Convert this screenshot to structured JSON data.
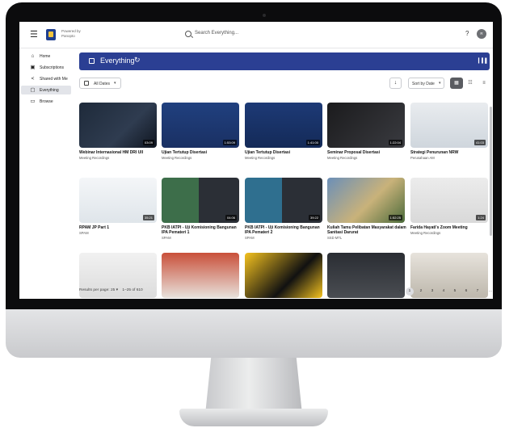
{
  "header": {
    "powered_by": "Powered by Panopto",
    "search_placeholder": "Search Everything...",
    "help": "?",
    "avatar_initials": "R"
  },
  "sidebar": {
    "items": [
      {
        "label": "Home",
        "icon": "home-icon",
        "glyph": "⌂"
      },
      {
        "label": "Subscriptions",
        "icon": "subscriptions-icon",
        "glyph": "▣"
      },
      {
        "label": "Shared with Me",
        "icon": "share-icon",
        "glyph": "<"
      },
      {
        "label": "Everything",
        "icon": "everything-icon",
        "glyph": "▢",
        "active": true
      },
      {
        "label": "Browse",
        "icon": "folder-icon",
        "glyph": "▭"
      }
    ]
  },
  "main": {
    "title": "Everything",
    "filter_label": "All Dates",
    "sort_label": "Sort by Date",
    "accent_color": "#2b3f93"
  },
  "sessions": [
    {
      "title": "Webinar Internasional HM DRI UII",
      "folder": "Meeting Recordings",
      "duration": "03:09"
    },
    {
      "title": "Ujian Tertutup Disertasi",
      "folder": "Meeting Recordings",
      "duration": "1:53:09"
    },
    {
      "title": "Ujian Tertutup Disertasi",
      "folder": "Meeting Recordings",
      "duration": "1:41:00"
    },
    {
      "title": "Seminar Proposal Disertasi",
      "folder": "Meeting Recordings",
      "duration": "1:22:04"
    },
    {
      "title": "Strategi Penurunan NRW",
      "folder": "Perusahaan AM",
      "duration": "41:03"
    },
    {
      "title": "RPAM JP Part 1",
      "folder": "SPAM",
      "duration": "35:21"
    },
    {
      "title": "PKB IATPI - Uji Komisioning Bangunan IPA Pemateri 1",
      "folder": "SPAM",
      "duration": "04:06"
    },
    {
      "title": "PKB IATPI - Uji Komisioning Bangunan IPA Pemateri 2",
      "folder": "SPAM",
      "duration": "39:22"
    },
    {
      "title": "Kuliah Tamu Pelibatan Masyarakat dalam Sanitasi Darurat",
      "folder": "SSD MTL",
      "duration": "1:52:25"
    },
    {
      "title": "Farida Hayati's Zoom Meeting",
      "folder": "Meeting Recordings",
      "duration": "1:24"
    },
    {
      "title": "",
      "folder": "",
      "duration": ""
    },
    {
      "title": "",
      "folder": "",
      "duration": ""
    },
    {
      "title": "",
      "folder": "",
      "duration": ""
    },
    {
      "title": "",
      "folder": "",
      "duration": ""
    },
    {
      "title": "",
      "folder": "",
      "duration": ""
    }
  ],
  "pagination": {
    "rows_per_page_label": "Results per page:",
    "rows_per_page": "25",
    "range": "1–25 of 610",
    "pages": [
      "1",
      "2",
      "3",
      "4",
      "5",
      "6",
      "7",
      "...",
      "25"
    ],
    "current": "1"
  }
}
